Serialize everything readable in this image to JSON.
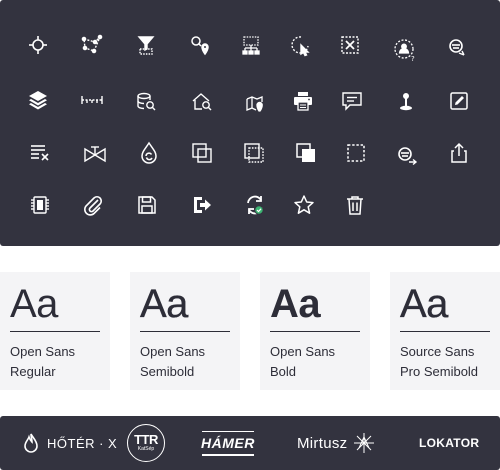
{
  "icons": [
    "crosshair-icon",
    "polygon-measure-icon",
    "filter-selection-icon",
    "location-search-icon",
    "network-select-icon",
    "lasso-select-icon",
    "box-deselect-icon",
    "user-query-icon",
    "identify-icon",
    "layers-icon",
    "distance-ruler-icon",
    "database-search-icon",
    "address-search-icon",
    "map-search-icon",
    "print-icon",
    "comment-icon",
    "location-pin-icon",
    "edit-icon",
    "clear-list-icon",
    "valve-icon",
    "water-drop-refresh-icon",
    "copy-overlap-icon",
    "frame-select-icon",
    "duplicate-icon",
    "dashed-selection-icon",
    "identify-forward-icon",
    "share-icon",
    "memory-chip-icon",
    "paperclip-icon",
    "save-icon",
    "logout-icon",
    "refresh-check-icon",
    "star-icon",
    "trash-icon"
  ],
  "fonts": [
    {
      "sample": "Aa",
      "name_line1": "Open Sans",
      "name_line2": "Regular"
    },
    {
      "sample": "Aa",
      "name_line1": "Open Sans",
      "name_line2": "Semibold"
    },
    {
      "sample": "Aa",
      "name_line1": "Open Sans",
      "name_line2": "Bold"
    },
    {
      "sample": "Aa",
      "name_line1": "Source Sans",
      "name_line2": "Pro Semibold"
    }
  ],
  "logos": {
    "hoter": "HŐTÉR · X",
    "ttr_main": "TTR",
    "ttr_sub": "KatSép",
    "hamer": "HÁMER",
    "mirtusz": "Mirtusz",
    "lokator": "LOKATOR"
  },
  "colors": {
    "panel_bg": "#33333f",
    "icon_color": "#ffffff",
    "card_bg": "#f4f4f6",
    "text_dark": "#2d2d38",
    "accent_green": "#3cb371"
  }
}
